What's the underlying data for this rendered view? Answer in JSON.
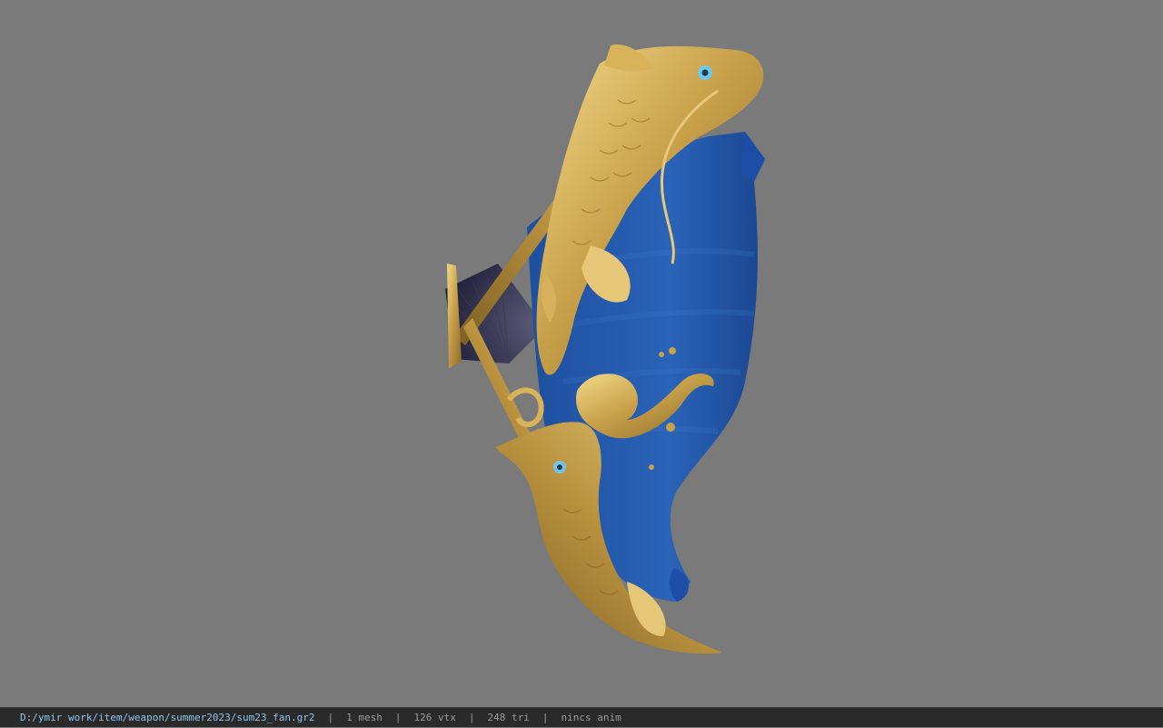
{
  "viewport": {
    "model_name": "koi fan weapon model"
  },
  "status_bar": {
    "path": "D:/ymir work/item/weapon/summer2023/sum23_fan.gr2",
    "separator": "|",
    "mesh_count": "1 mesh",
    "vertex_count": "126 vtx",
    "triangle_count": "248 tri",
    "animation": "nincs anim"
  },
  "colors": {
    "background": "#7a7a7a",
    "status_bar_bg": "#2a2a2a",
    "path_text": "#8fc4e8",
    "stat_text": "#9a9a9a"
  }
}
